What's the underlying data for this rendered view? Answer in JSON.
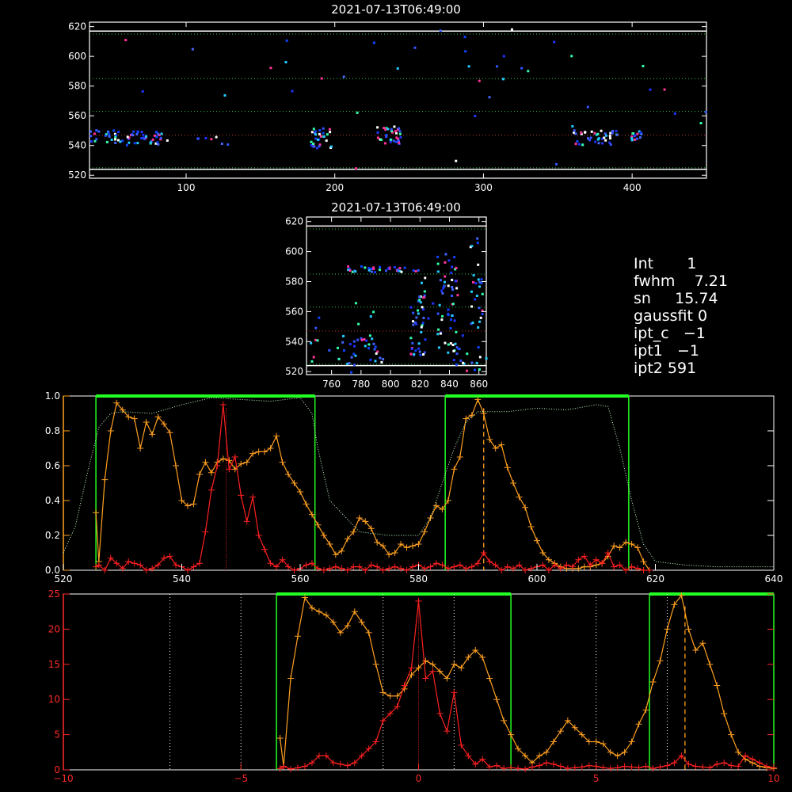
{
  "top_panel": {
    "title": "2021-07-13T06:49:00",
    "xticks": [
      "100",
      "200",
      "300",
      "400"
    ],
    "yticks": [
      "520",
      "540",
      "560",
      "580",
      "600",
      "620"
    ],
    "xlim": [
      35,
      450
    ],
    "ylim": [
      518,
      623
    ]
  },
  "mid_panel": {
    "title": "2021-07-13T06:49:00",
    "xticks": [
      "760",
      "780",
      "800",
      "820",
      "840",
      "860"
    ],
    "yticks": [
      "520",
      "540",
      "560",
      "580",
      "600",
      "620"
    ],
    "xlim": [
      743,
      865
    ],
    "ylim": [
      518,
      623
    ]
  },
  "info": {
    "lines": [
      "Int       1",
      "fwhm    7.21",
      "sn     15.74",
      "gaussfit 0",
      "ipt_c   −1",
      "ipt1   −1",
      "ipt2 591"
    ]
  },
  "chart_data": [
    {
      "type": "line",
      "title": "",
      "xlim": [
        520,
        640
      ],
      "ylim": [
        0,
        1.0
      ],
      "xticks": [
        "520",
        "540",
        "560",
        "580",
        "600",
        "620",
        "640"
      ],
      "yticks": [
        "0.0",
        "0.2",
        "0.4",
        "0.6",
        "0.8",
        "1.0"
      ],
      "colors": {
        "orange": "#ffa020",
        "red": "#ff2020",
        "green": "#22ff22",
        "dotted": "#c8ffc8"
      },
      "series": [
        {
          "values_x": [
            525.5,
            526,
            527,
            528,
            529,
            530,
            531,
            532,
            533,
            534,
            535,
            536,
            537,
            538,
            539,
            540,
            541,
            542,
            543,
            544,
            545,
            546,
            547,
            548,
            549,
            550,
            551,
            552,
            553,
            554,
            555,
            556,
            557,
            558,
            559,
            560,
            561,
            562,
            563,
            564,
            565,
            566,
            567,
            568,
            569,
            570,
            571,
            572,
            573,
            574,
            575,
            576,
            577,
            578,
            579,
            580,
            581,
            582,
            583,
            584,
            585,
            586,
            587,
            588,
            589,
            590,
            591,
            592,
            593,
            594,
            595,
            596,
            597,
            598,
            599,
            600,
            601,
            602,
            603,
            604,
            605,
            606,
            607,
            608,
            609,
            610,
            611,
            612,
            613,
            614,
            615,
            616,
            617,
            618,
            619
          ],
          "values_y": [
            0.33,
            0.05,
            0.52,
            0.8,
            0.96,
            0.92,
            0.88,
            0.87,
            0.7,
            0.85,
            0.78,
            0.88,
            0.84,
            0.79,
            0.6,
            0.4,
            0.37,
            0.38,
            0.55,
            0.62,
            0.56,
            0.62,
            0.64,
            0.63,
            0.58,
            0.61,
            0.62,
            0.67,
            0.68,
            0.68,
            0.7,
            0.77,
            0.62,
            0.55,
            0.5,
            0.45,
            0.38,
            0.32,
            0.26,
            0.2,
            0.15,
            0.09,
            0.11,
            0.18,
            0.22,
            0.3,
            0.28,
            0.24,
            0.16,
            0.14,
            0.09,
            0.1,
            0.15,
            0.13,
            0.14,
            0.15,
            0.22,
            0.3,
            0.37,
            0.35,
            0.4,
            0.58,
            0.65,
            0.87,
            0.89,
            0.98,
            0.9,
            0.75,
            0.7,
            0.72,
            0.59,
            0.5,
            0.42,
            0.36,
            0.25,
            0.17,
            0.1,
            0.06,
            0.04,
            0.02,
            0.01,
            0.01,
            0.01,
            0.02,
            0.02,
            0.03,
            0.04,
            0.08,
            0.14,
            0.13,
            0.16,
            0.15,
            0.13,
            0.05,
            0.0
          ]
        },
        {
          "values_x": [
            525.5,
            526,
            527,
            528,
            529,
            530,
            531,
            532,
            533,
            534,
            535,
            536,
            537,
            538,
            539,
            540,
            541,
            542,
            543,
            544,
            545,
            546,
            547,
            548,
            549,
            550,
            551,
            552,
            553,
            554,
            555,
            556,
            557,
            558,
            559,
            560,
            561,
            562,
            563,
            564,
            565,
            566,
            567,
            568,
            569,
            570,
            571,
            572,
            573,
            574,
            575,
            576,
            577,
            578,
            579,
            580,
            581,
            582,
            583,
            584,
            585,
            586,
            587,
            588,
            589,
            590,
            591,
            592,
            593,
            594,
            595,
            596,
            597,
            598,
            599,
            600,
            601,
            602,
            603,
            604,
            605,
            606,
            607,
            608,
            609,
            610,
            611,
            612,
            613,
            614,
            615,
            616,
            617,
            618,
            619
          ],
          "values_y": [
            0.02,
            0.03,
            0.0,
            0.07,
            0.04,
            0.01,
            0.05,
            0.04,
            0.03,
            0.0,
            0.01,
            0.03,
            0.07,
            0.08,
            0.03,
            0.02,
            0.0,
            0.02,
            0.04,
            0.22,
            0.46,
            0.6,
            0.95,
            0.58,
            0.65,
            0.43,
            0.28,
            0.42,
            0.2,
            0.12,
            0.04,
            0.02,
            0.06,
            0.02,
            0.0,
            0.01,
            0.03,
            0.04,
            0.01,
            0.0,
            0.01,
            0.02,
            0.01,
            0.0,
            0.02,
            0.02,
            0.0,
            0.03,
            0.02,
            0.0,
            0.01,
            0.02,
            0.01,
            0.0,
            0.02,
            0.03,
            0.01,
            0.02,
            0.04,
            0.03,
            0.01,
            0.02,
            0.03,
            0.01,
            0.02,
            0.04,
            0.1,
            0.05,
            0.03,
            0.0,
            0.02,
            0.01,
            0.03,
            0.0,
            0.01,
            0.02,
            0.03,
            0.0,
            0.03,
            0.01,
            0.03,
            0.02,
            0.06,
            0.08,
            0.03,
            0.06,
            0.04,
            0.1,
            0.02,
            0.03,
            0.0,
            0.02,
            0.01,
            0.0,
            0.0
          ]
        },
        {
          "values_x": [
            520,
            522,
            524,
            526,
            528,
            530,
            535,
            540,
            545,
            550,
            555,
            560,
            562,
            563,
            565,
            570,
            575,
            580,
            582,
            584,
            586,
            588,
            590,
            595,
            600,
            605,
            610,
            612,
            614,
            616,
            618,
            620,
            625,
            630,
            640
          ],
          "values_y": [
            0.1,
            0.25,
            0.55,
            0.82,
            0.9,
            0.91,
            0.9,
            0.95,
            0.99,
            0.98,
            0.97,
            0.99,
            0.9,
            0.7,
            0.4,
            0.22,
            0.2,
            0.2,
            0.3,
            0.5,
            0.7,
            0.85,
            0.91,
            0.91,
            0.93,
            0.92,
            0.95,
            0.94,
            0.7,
            0.4,
            0.15,
            0.05,
            0.03,
            0.02,
            0.02
          ]
        }
      ],
      "green_boxes": [
        [
          525.5,
          562.5
        ],
        [
          584.5,
          615.5
        ]
      ],
      "markers": {
        "red_dotted": 547.5,
        "orange_dashed": 591
      }
    },
    {
      "type": "line",
      "title": "",
      "xlim": [
        -10,
        10
      ],
      "ylim": [
        0,
        25
      ],
      "xticks": [
        "−10",
        "−5",
        "0",
        "5",
        "10"
      ],
      "yticks": [
        "0",
        "5",
        "10",
        "15",
        "20",
        "25"
      ],
      "series": [
        {
          "values_x": [
            -3.9,
            -3.8,
            -3.6,
            -3.4,
            -3.2,
            -3.0,
            -2.8,
            -2.6,
            -2.4,
            -2.2,
            -2.0,
            -1.8,
            -1.6,
            -1.4,
            -1.2,
            -1.0,
            -0.8,
            -0.6,
            -0.4,
            -0.2,
            0.0,
            0.2,
            0.4,
            0.6,
            0.8,
            1.0,
            1.2,
            1.4,
            1.6,
            1.8,
            2.0,
            2.2,
            2.4,
            2.6,
            2.8,
            3.0,
            3.2,
            3.4,
            3.6,
            3.8,
            4.0,
            4.2,
            4.4,
            4.6,
            4.8,
            5.0,
            5.2,
            5.4,
            5.6,
            5.8,
            6.0,
            6.2,
            6.4,
            6.6,
            6.8,
            7.0,
            7.2,
            7.4,
            7.6,
            7.8,
            8.0,
            8.2,
            8.4,
            8.6,
            8.8,
            9.0,
            9.2,
            9.4,
            9.6,
            9.8,
            10
          ],
          "values_y": [
            4.5,
            0.5,
            13,
            19,
            24.5,
            23,
            22.5,
            22,
            21,
            19.5,
            20.5,
            22.5,
            21,
            19.5,
            15,
            11,
            10.5,
            10.5,
            11.5,
            13.5,
            14.5,
            15.5,
            15,
            14,
            13,
            15,
            14.5,
            16,
            17,
            16,
            13,
            10,
            7,
            5,
            3,
            2,
            1,
            2,
            2.5,
            4,
            5.5,
            7,
            6,
            5,
            4,
            4,
            3.7,
            2.5,
            2,
            2.5,
            4,
            6.5,
            8.5,
            12.5,
            15.5,
            20,
            23.5,
            24.8,
            20,
            17,
            18,
            15,
            12,
            8,
            5,
            2.5,
            1.5,
            1,
            0.5,
            0.3,
            0.2
          ]
        },
        {
          "values_x": [
            -3.9,
            -3.8,
            -3.6,
            -3.4,
            -3.2,
            -3.0,
            -2.8,
            -2.6,
            -2.4,
            -2.2,
            -2.0,
            -1.8,
            -1.6,
            -1.4,
            -1.2,
            -1.0,
            -0.8,
            -0.6,
            -0.4,
            -0.2,
            0.0,
            0.2,
            0.4,
            0.6,
            0.8,
            1.0,
            1.2,
            1.4,
            1.6,
            1.8,
            2.0,
            2.2,
            2.4,
            2.6,
            2.8,
            3.0,
            3.2,
            3.4,
            3.6,
            3.8,
            4.0,
            4.2,
            4.4,
            4.6,
            4.8,
            5.0,
            5.2,
            5.4,
            5.6,
            5.8,
            6.0,
            6.2,
            6.4,
            6.6,
            6.8,
            7.0,
            7.2,
            7.4,
            7.6,
            7.8,
            8.0,
            8.2,
            8.4,
            8.6,
            8.8,
            9.0,
            9.2,
            9.4,
            9.6,
            9.8,
            10
          ],
          "values_y": [
            0.2,
            0.5,
            0.1,
            0.3,
            0.5,
            1,
            2,
            2,
            1,
            0.8,
            0.6,
            1,
            2,
            3,
            4,
            7,
            8,
            9,
            12,
            14.5,
            24,
            13,
            14,
            8,
            5.5,
            11,
            3.5,
            2,
            0.8,
            1.5,
            0.4,
            0.6,
            0.2,
            0.3,
            0.2,
            0.1,
            0.4,
            0.6,
            1,
            0.8,
            0.5,
            0.2,
            0.3,
            0.4,
            0.6,
            0.5,
            0.3,
            0.2,
            0.3,
            0.5,
            0.4,
            0.3,
            0.5,
            0.2,
            0.4,
            0.6,
            1,
            2,
            0.8,
            0.5,
            0.4,
            0.3,
            0.8,
            1,
            0.6,
            0.5,
            2,
            1.5,
            1,
            0.5,
            0.3
          ]
        }
      ],
      "green_boxes": [
        [
          -4.0,
          2.6
        ],
        [
          6.5,
          10
        ]
      ],
      "markers": {
        "dotted_lines": [
          -7,
          -5,
          -1,
          1,
          5,
          7
        ],
        "red_dotted": 0,
        "orange_dashed": 7.5
      }
    }
  ]
}
